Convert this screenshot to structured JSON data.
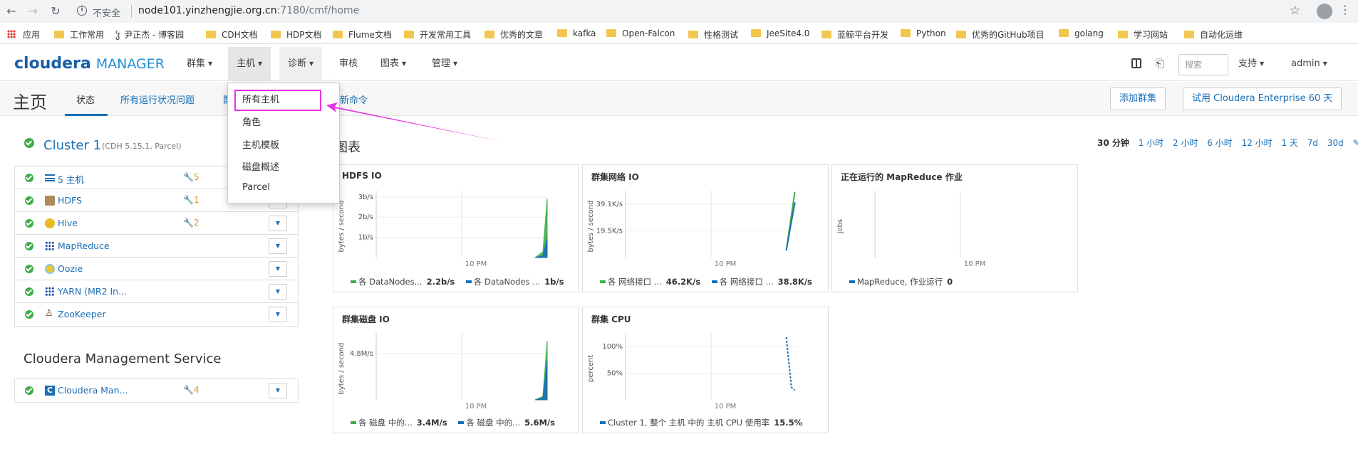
{
  "browser": {
    "url_insecure": "不安全",
    "url_host": "node101.yinzhengjie.org.cn",
    "url_path": ":7180/cmf/home"
  },
  "bookmarks": [
    {
      "label": "应用"
    },
    {
      "label": "工作常用"
    },
    {
      "label": "尹正杰 - 博客园"
    },
    {
      "label": "CDH文档"
    },
    {
      "label": "HDP文档"
    },
    {
      "label": "Flume文档"
    },
    {
      "label": "开发常用工具"
    },
    {
      "label": "优秀的文章"
    },
    {
      "label": "kafka"
    },
    {
      "label": "Open-Falcon"
    },
    {
      "label": "性格测试"
    },
    {
      "label": "JeeSite4.0"
    },
    {
      "label": "蓝鲸平台开发"
    },
    {
      "label": "Python"
    },
    {
      "label": "优秀的GitHub项目"
    },
    {
      "label": "golang"
    },
    {
      "label": "学习网站"
    },
    {
      "label": "自动化运维"
    }
  ],
  "cm": {
    "logo_bold": "cloudera",
    "logo_light": "MANAGER",
    "nav": [
      "群集",
      "主机",
      "诊断",
      "审核",
      "图表",
      "管理"
    ],
    "search_placeholder": "搜索",
    "support": "支持",
    "user": "admin"
  },
  "subhead": {
    "title": "主页",
    "tabs": [
      "状态",
      "所有运行状况问题",
      "配",
      "新命令"
    ],
    "add_cluster": "添加群集",
    "trial": "试用 Cloudera Enterprise 60 天"
  },
  "hosts_menu": [
    "所有主机",
    "角色",
    "主机模板",
    "磁盘概述",
    "Parcel"
  ],
  "cluster": {
    "name": "Cluster 1",
    "version": "(CDH 5.15.1, Parcel)",
    "services": [
      {
        "name": "5 主机",
        "warn": "5",
        "icon": "list-icon",
        "icon_color": "#1a6fb5"
      },
      {
        "name": "HDFS",
        "warn": "1",
        "icon": "hdfs-icon",
        "icon_color": "#8a6b3d"
      },
      {
        "name": "Hive",
        "warn": "2",
        "icon": "hive-icon",
        "icon_color": "#e8b923"
      },
      {
        "name": "MapReduce",
        "warn": "",
        "icon": "mapreduce-icon",
        "icon_color": "#2a4fa8"
      },
      {
        "name": "Oozie",
        "warn": "",
        "icon": "oozie-icon",
        "icon_color": "#e8c82b"
      },
      {
        "name": "YARN (MR2 In...",
        "warn": "",
        "icon": "yarn-icon",
        "icon_color": "#2a4fa8"
      },
      {
        "name": "ZooKeeper",
        "warn": "",
        "icon": "zookeeper-icon",
        "icon_color": "#6a5a3a"
      }
    ]
  },
  "mgmt": {
    "title": "Cloudera Management Service",
    "services": [
      {
        "name": "Cloudera Man...",
        "warn": "4",
        "icon": "cloudera-c-icon",
        "icon_color": "#1a6fb5"
      }
    ]
  },
  "charts_section": {
    "title": "图表",
    "time_ranges": [
      "30 分钟",
      "1 小时",
      "2 小时",
      "6 小时",
      "12 小时",
      "1 天",
      "7d",
      "30d"
    ]
  },
  "chart_data": [
    {
      "type": "area",
      "title": "HDFS IO",
      "ylabel": "bytes / second",
      "yticks": [
        "1b/s",
        "2b/s",
        "3b/s"
      ],
      "ymax": 3.3,
      "xticks": [
        "10 PM"
      ],
      "series": [
        {
          "name": "各 DataNodes...",
          "color": "#3fae49",
          "latest": "2.2b/s",
          "x": [
            0.93,
            0.975,
            1.0
          ],
          "y": [
            0,
            0.3,
            3.1
          ]
        },
        {
          "name": "各 DataNodes ...",
          "color": "#1a6fb5",
          "latest": "1b/s",
          "x": [
            0.93,
            0.975,
            1.0
          ],
          "y": [
            0,
            0.1,
            1.0
          ]
        }
      ]
    },
    {
      "type": "line",
      "title": "群集网络 IO",
      "ylabel": "bytes / second",
      "yticks": [
        "19.5K/s",
        "39.1K/s"
      ],
      "ymax": 44000,
      "xticks": [
        "10 PM"
      ],
      "series": [
        {
          "name": "各 网络接口 ...",
          "color": "#3fae49",
          "latest": "46.2K/s",
          "x": [
            0.94,
            0.99
          ],
          "y": [
            5000,
            46200
          ]
        },
        {
          "name": "各 网络接口 ...",
          "color": "#1a6fb5",
          "latest": "38.8K/s",
          "x": [
            0.94,
            0.99
          ],
          "y": [
            5000,
            38800
          ]
        }
      ]
    },
    {
      "type": "line",
      "title": "正在运行的 MapReduce 作业",
      "ylabel": "jobs",
      "yticks": [],
      "ymax": 1,
      "xticks": [
        "10 PM"
      ],
      "series": [
        {
          "name": "MapReduce, 作业运行",
          "color": "#1a6fb5",
          "latest": "0",
          "x": [],
          "y": []
        }
      ]
    },
    {
      "type": "area",
      "title": "群集磁盘 IO",
      "ylabel": "bytes / second",
      "yticks": [
        "4.8M/s"
      ],
      "ymax": 9,
      "xticks": [
        "10 PM"
      ],
      "series": [
        {
          "name": "各 磁盘 中的...",
          "color": "#3fae49",
          "latest": "3.4M/s",
          "x": [
            0.93,
            0.975,
            1.0
          ],
          "y": [
            0,
            0.5,
            8.5
          ]
        },
        {
          "name": "各 磁盘 中的...",
          "color": "#1a6fb5",
          "latest": "5.6M/s",
          "x": [
            0.93,
            0.975,
            1.0
          ],
          "y": [
            0,
            0.3,
            5.6
          ]
        }
      ]
    },
    {
      "type": "line",
      "title": "群集 CPU",
      "ylabel": "percent",
      "yticks": [
        "50%",
        "100%"
      ],
      "ymax": 100,
      "xticks": [
        "10 PM"
      ],
      "series": [
        {
          "name": "Cluster 1, 整个 主机 中的 主机 CPU 使用率",
          "color": "#1a6fb5",
          "latest": "15.5%",
          "x": [
            0.94,
            0.97,
            0.99
          ],
          "y": [
            100,
            20,
            15.5
          ]
        }
      ]
    }
  ]
}
